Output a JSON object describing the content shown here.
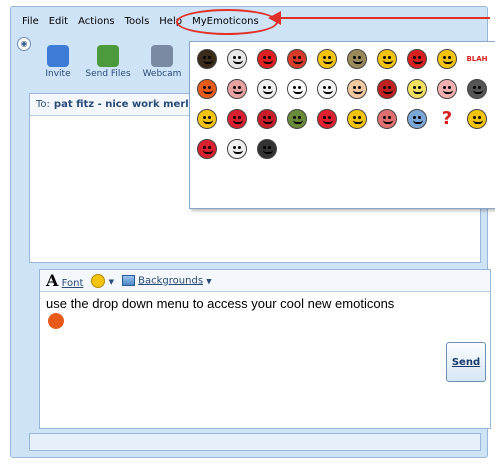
{
  "menubar": {
    "items": [
      "File",
      "Edit",
      "Actions",
      "Tools",
      "Help",
      "MyEmoticons"
    ]
  },
  "toolbar": {
    "buttons": [
      {
        "label": "Invite",
        "icon": "invite-icon",
        "color": "#3c7bd6"
      },
      {
        "label": "Send Files",
        "icon": "send-files-icon",
        "color": "#4c9a3c"
      },
      {
        "label": "Webcam",
        "icon": "webcam-icon",
        "color": "#7b8aa3"
      }
    ]
  },
  "conversation": {
    "to_label": "To:",
    "to_name": "pat fitz - nice work merl"
  },
  "compose": {
    "font_label": "Font",
    "backgrounds_label": "Backgrounds",
    "message": "use the drop down menu to access your cool new emoticons",
    "send_label": "Send"
  },
  "emoticon_menu": {
    "rows": [
      [
        {
          "name": "afro-emoticon",
          "color": "#3a2a1a"
        },
        {
          "name": "skull-emoticon",
          "color": "#e8e8e8"
        },
        {
          "name": "angry-red-emoticon",
          "color": "#e02020"
        },
        {
          "name": "rocket-emoticon",
          "color": "#d83a2a"
        },
        {
          "name": "winking-emoticon",
          "color": "#f2c40e"
        },
        {
          "name": "jail-emoticon",
          "color": "#9a8a5a"
        },
        {
          "name": "dancing-emoticon",
          "color": "#f2c40e"
        },
        {
          "name": "red-devil-emoticon",
          "color": "#d82020"
        },
        {
          "name": "nerd-emoticon",
          "color": "#f2c40e"
        },
        {
          "name": "blah-text-emoticon",
          "text": "BLAH",
          "color": "#d81e1e"
        }
      ],
      [
        {
          "name": "party-emoticon",
          "color": "#e85a1a"
        },
        {
          "name": "cupid-emoticon",
          "color": "#e8a0a0"
        },
        {
          "name": "cow-emoticon",
          "color": "#f0f0f0"
        },
        {
          "name": "eyes-emoticon",
          "color": "#ffffff"
        },
        {
          "name": "panda-emoticon",
          "color": "#f5f5f5"
        },
        {
          "name": "finger-emoticon",
          "color": "#f2c8a0"
        },
        {
          "name": "pirate-emoticon",
          "color": "#c02020"
        },
        {
          "name": "halo-emoticon",
          "color": "#f2e060"
        },
        {
          "name": "bottom-emoticon",
          "color": "#f0b0b0"
        },
        {
          "name": "gun-emoticon",
          "color": "#555555"
        }
      ],
      [
        {
          "name": "kiss-emoticon",
          "color": "#f2c40e"
        },
        {
          "name": "heart-face-emoticon",
          "color": "#d82030"
        },
        {
          "name": "i-love-you-emoticon",
          "color": "#c81e2a"
        },
        {
          "name": "zombie-emoticon",
          "color": "#6a8a3a"
        },
        {
          "name": "lips-emoticon",
          "color": "#e02030"
        },
        {
          "name": "cool-emoticon",
          "color": "#f2c40e"
        },
        {
          "name": "grandma-emoticon",
          "color": "#e07070"
        },
        {
          "name": "shark-emoticon",
          "color": "#7aa6d8"
        },
        {
          "name": "question-mark-emoticon",
          "text": "?",
          "color": "#d81e1e"
        },
        {
          "name": "glasses-emoticon",
          "color": "#f2c40e"
        }
      ],
      [
        {
          "name": "rose-emoticon",
          "color": "#d82030"
        },
        {
          "name": "sheep-emoticon",
          "color": "#f0f0f0"
        },
        {
          "name": "tv-emoticon",
          "color": "#333333"
        }
      ]
    ]
  },
  "message_emoticon": {
    "name": "party-emoticon",
    "color": "#e85a1a"
  },
  "annotation": {
    "color": "#e03028"
  }
}
